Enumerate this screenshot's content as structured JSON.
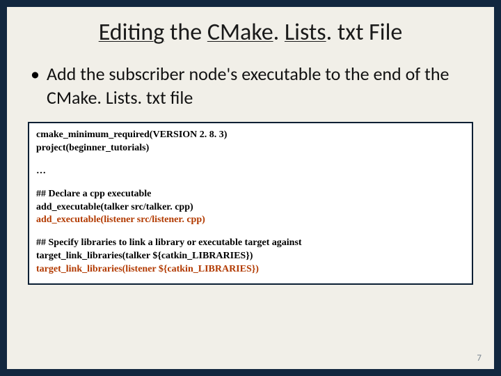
{
  "title_parts": {
    "p1": "Editing",
    "p2": " the ",
    "p3": "CMake",
    "p4": ". ",
    "p5": "Lists",
    "p6": ". txt File"
  },
  "bullet": "Add the subscriber node's executable to the end of the CMake. Lists. txt file",
  "code": {
    "l1": "cmake_minimum_required(VERSION 2. 8. 3)",
    "l2": "project(beginner_tutorials)",
    "ellipsis": "…",
    "l3": "## Declare a cpp executable",
    "l4": "add_executable(talker src/talker. cpp)",
    "l5": "add_executable(listener src/listener. cpp)",
    "l6": "## Specify libraries to link a library or executable target against",
    "l7": "target_link_libraries(talker ${catkin_LIBRARIES})",
    "l8": "target_link_libraries(listener ${catkin_LIBRARIES})"
  },
  "page_number": "7"
}
